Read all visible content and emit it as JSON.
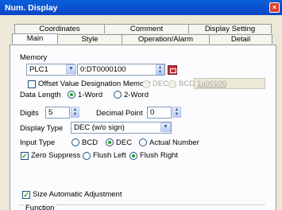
{
  "window": {
    "title": "Num. Display",
    "close_glyph": "×"
  },
  "tabs_row1": [
    "Coordinates",
    "Comment",
    "Display Setting"
  ],
  "tabs_row2": [
    "Main",
    "Style",
    "Operation/Alarm",
    "Detail"
  ],
  "memory": {
    "label": "Memory",
    "device": "PLC1",
    "address": "0:DT0000100",
    "offset_label": "Offset Value Designation Memory",
    "dec_label": "DEC",
    "bcd_label": "BCD",
    "offset_address": "1u00100"
  },
  "data_length": {
    "label": "Data Length",
    "opt1": "1-Word",
    "opt2": "2-Word",
    "selected": "1-Word"
  },
  "digits": {
    "label": "Digits",
    "value": "5"
  },
  "decimal_point": {
    "label": "Decimal Point",
    "value": "0"
  },
  "display_type": {
    "label": "Display Type",
    "value": "DEC (w/o sign)"
  },
  "input_type": {
    "label": "Input Type",
    "opt1": "BCD",
    "opt2": "DEC",
    "opt3": "Actual Number",
    "selected": "DEC"
  },
  "zero_suppress": {
    "label": "Zero Suppress",
    "checked": true,
    "flush_left": "Flush Left",
    "flush_right": "Flush Right",
    "selected": "Flush Right"
  },
  "size_auto": {
    "label": "Size Automatic Adjustment",
    "checked": true
  },
  "function": {
    "label": "Function"
  },
  "icons": {
    "dropdown": "chevron-down-icon",
    "spin": "spin-arrows-icon",
    "memory_picker": "memory-picker-icon",
    "check": "check-icon"
  }
}
